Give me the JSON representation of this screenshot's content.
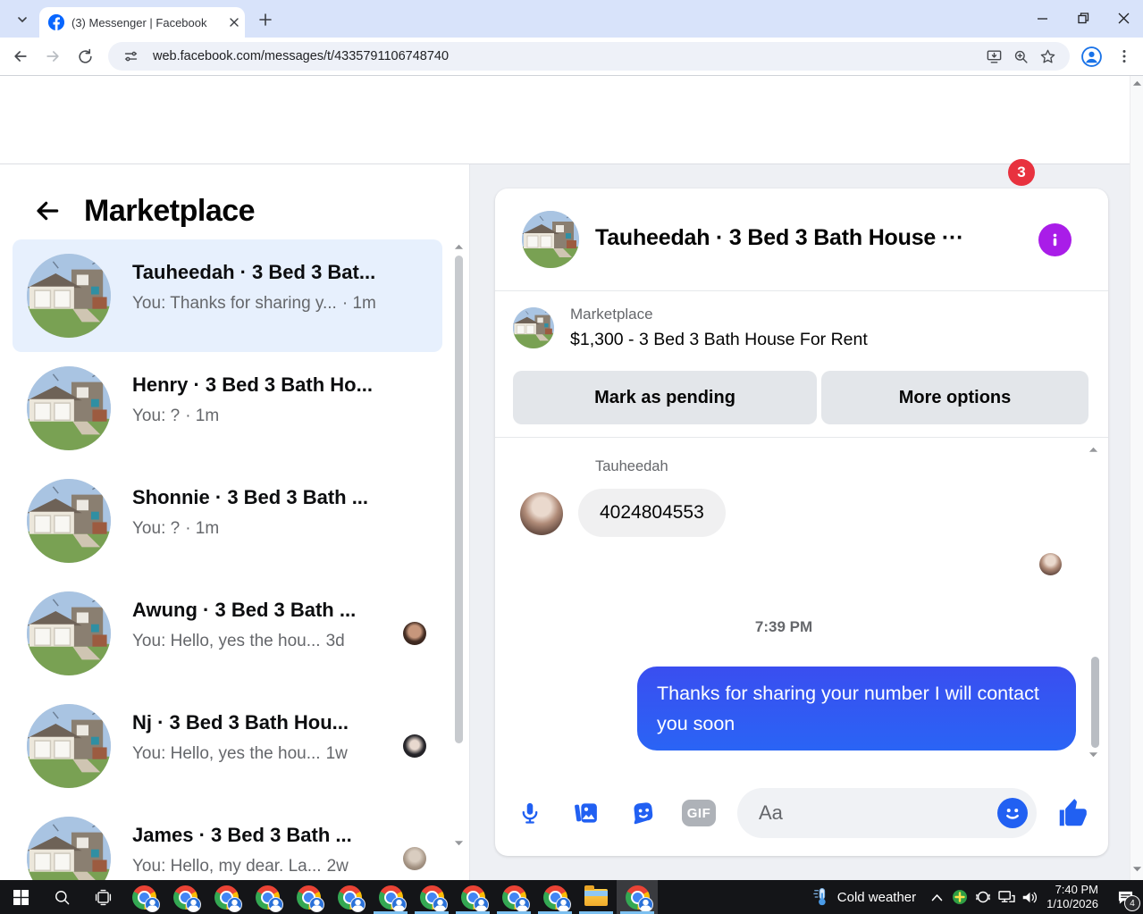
{
  "browser": {
    "tab_title": "(3) Messenger | Facebook",
    "url": "web.facebook.com/messages/t/4335791106748740"
  },
  "fb_header": {
    "notification_badge": "3"
  },
  "sidebar": {
    "title": "Marketplace",
    "conversations": [
      {
        "title": "Tauheedah · 3 Bed 3 Bat...",
        "snippet": "You: Thanks for sharing y...",
        "time": "· 1m",
        "selected": true
      },
      {
        "title": "Henry · 3 Bed 3 Bath Ho...",
        "snippet": "You: ?",
        "time": "· 1m"
      },
      {
        "title": "Shonnie · 3 Bed 3 Bath ...",
        "snippet": "You: ?",
        "time": "· 1m"
      },
      {
        "title": "Awung · 3 Bed 3 Bath ...",
        "snippet": "You: Hello, yes the hou...",
        "time": "3d",
        "buddy": "awung"
      },
      {
        "title": "Nj · 3 Bed 3 Bath Hou...",
        "snippet": "You: Hello, yes the hou...",
        "time": "1w",
        "buddy": "nj"
      },
      {
        "title": "James · 3 Bed 3 Bath ...",
        "snippet": "You: Hello, my dear. La...",
        "time": "2w",
        "buddy": "james"
      }
    ]
  },
  "chat": {
    "header_title": "Tauheedah · 3 Bed 3 Bath House ···",
    "listing": {
      "label": "Marketplace",
      "headline": "$1,300 - 3 Bed 3 Bath House For Rent",
      "primary_button": "Mark as pending",
      "secondary_button": "More options"
    },
    "messages": {
      "sender_name": "Tauheedah",
      "incoming_text": "4024804553",
      "timestamp": "7:39 PM",
      "outgoing_text": "Thanks for sharing your number I will contact you soon"
    },
    "composer": {
      "placeholder": "Aa",
      "gif_label": "GIF"
    }
  },
  "taskbar": {
    "weather_label": "Cold weather",
    "clock_time": "7:40 PM",
    "clock_date": "1/10/2026",
    "notification_badge": "4"
  },
  "colors": {
    "fb_blue": "#0866ff",
    "accent_blue": "#2160f2",
    "bubble_top": "#3a4ef0",
    "bubble_bottom": "#2a64f5",
    "info_purple": "#a91de8",
    "badge_red": "#e8323f",
    "selected_bg": "#e7f0fd"
  }
}
